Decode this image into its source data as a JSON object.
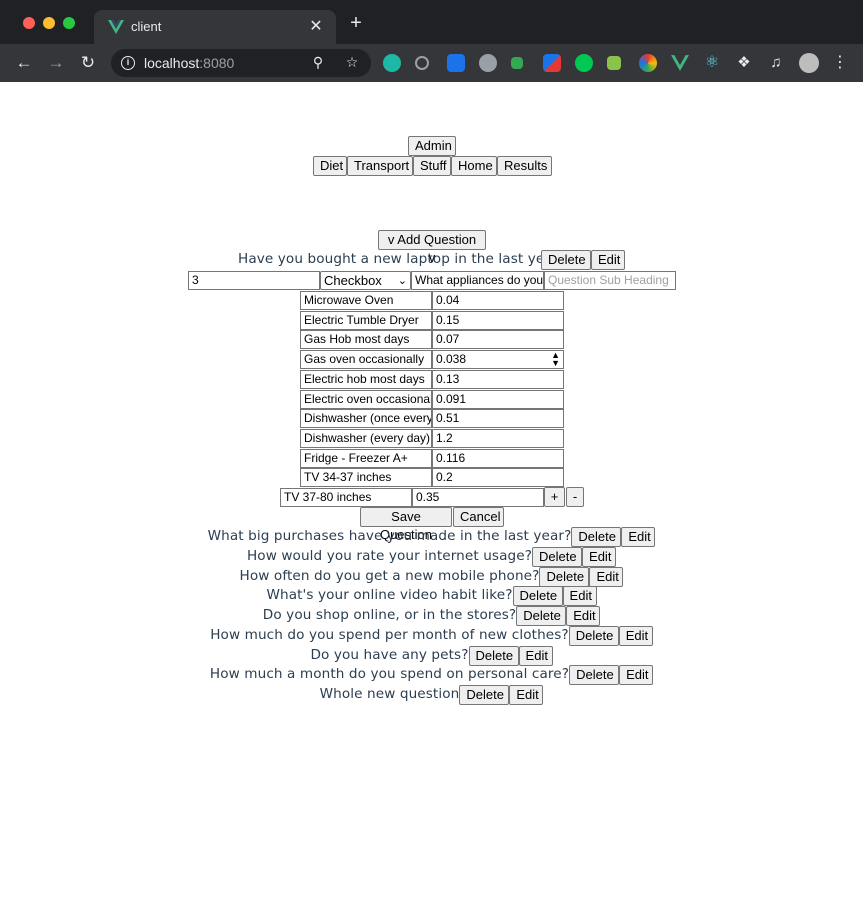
{
  "browser": {
    "tab_title": "client",
    "new_tab": "+",
    "close_tab": "✕",
    "url_host": "localhost",
    "url_port": ":8080",
    "icons": [
      "back-icon",
      "forward-icon",
      "reload-icon",
      "info-icon",
      "zoom-icon",
      "star-icon",
      "extensions-icon",
      "media-icon",
      "profile-avatar",
      "menu-icon"
    ]
  },
  "nav": {
    "admin": "Admin",
    "tabs": [
      "Diet",
      "Transport",
      "Stuff",
      "Home",
      "Results"
    ]
  },
  "editor": {
    "add_question": "v Add Question v",
    "current_question": "Have you bought a new laptop in the last year?",
    "number_value": "3",
    "type_selected": "Checkbox",
    "heading_value": "What appliances do you",
    "subheading_placeholder": "Question Sub Heading",
    "options": [
      {
        "label": "Microwave Oven",
        "value": "0.04"
      },
      {
        "label": "Electric Tumble Dryer",
        "value": "0.15"
      },
      {
        "label": "Gas Hob most days",
        "value": "0.07"
      },
      {
        "label": "Gas oven occasionally",
        "value": "0.038"
      },
      {
        "label": "Electric hob most days",
        "value": "0.13"
      },
      {
        "label": "Electric oven occasional",
        "value": "0.091"
      },
      {
        "label": "Dishwasher (once every",
        "value": "0.51"
      },
      {
        "label": "Dishwasher (every day)",
        "value": "1.2"
      },
      {
        "label": "Fridge - Freezer A+",
        "value": "0.116"
      },
      {
        "label": "TV 34-37 inches",
        "value": "0.2"
      },
      {
        "label": "TV 37-80 inches",
        "value": "0.35"
      }
    ],
    "plus": "+",
    "minus": "-",
    "save": "Save Question",
    "cancel": "Cancel"
  },
  "questions": [
    "What big purchases have you made in the last year?",
    "How would you rate your internet usage?",
    "How often do you get a new mobile phone?",
    "What's your online video habit like?",
    "Do you shop online, or in the stores?",
    "How much do you spend per month of new clothes?",
    "Do you have any pets?",
    "How much a month do you spend on personal care?",
    "Whole new question"
  ],
  "labels": {
    "delete": "Delete",
    "edit": "Edit"
  },
  "colors": {
    "text": "#2c3e50",
    "chrome_dark": "#202124",
    "chrome_toolbar": "#35363a"
  }
}
